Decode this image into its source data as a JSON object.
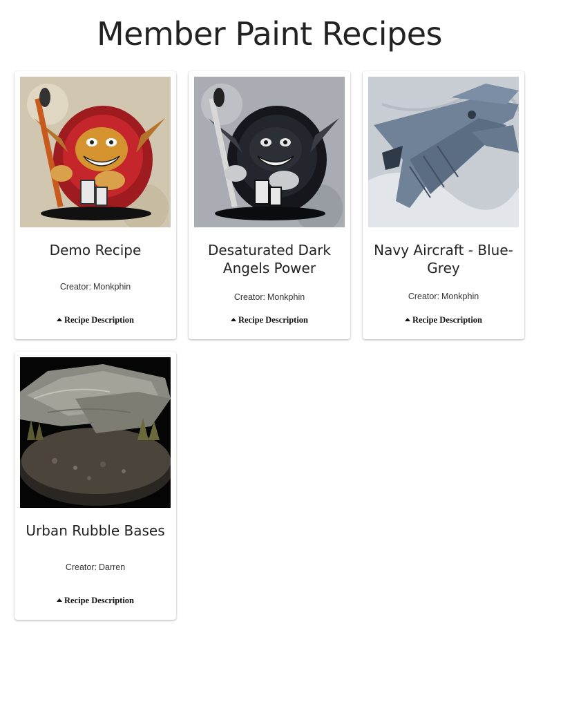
{
  "page": {
    "title": "Member Paint Recipes"
  },
  "recipes": [
    {
      "title": "Demo Recipe",
      "creator_label": "Creator:",
      "creator": "Monkphin",
      "toggle_label": "Recipe Description",
      "image": "goblin-painter-color"
    },
    {
      "title": "Desaturated Dark Angels Power",
      "creator_label": "Creator:",
      "creator": "Monkphin",
      "toggle_label": "Recipe Description",
      "image": "goblin-painter-desaturated"
    },
    {
      "title": "Navy Aircraft - Blue-Grey",
      "creator_label": "Creator:",
      "creator": "Monkphin",
      "toggle_label": "Recipe Description",
      "image": "blue-grey-aircraft-model"
    },
    {
      "title": "Urban Rubble Bases",
      "creator_label": "Creator:",
      "creator": "Darren",
      "toggle_label": "Recipe Description",
      "image": "rubble-base-model"
    }
  ]
}
